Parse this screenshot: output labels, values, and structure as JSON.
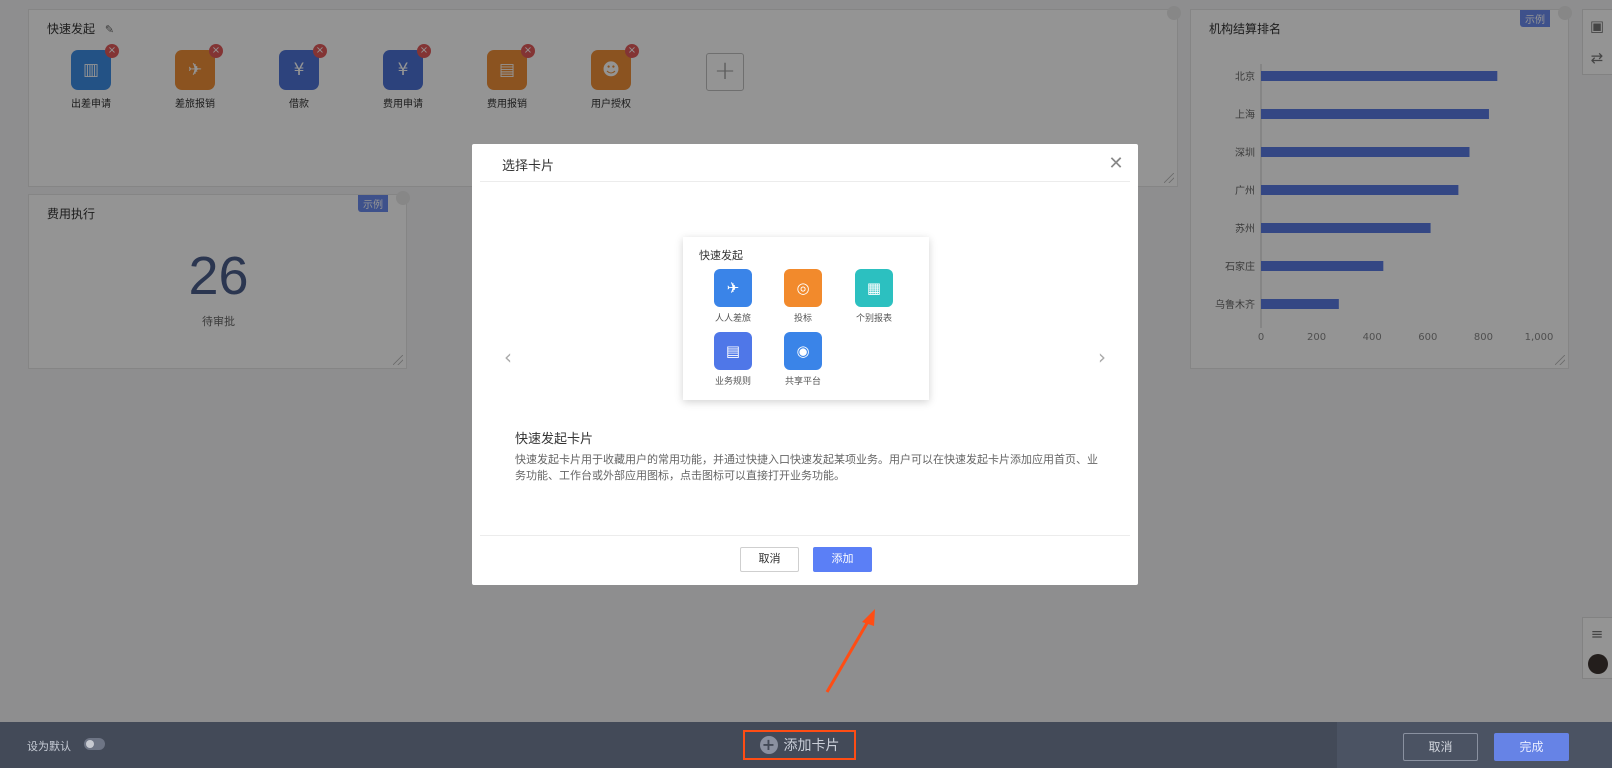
{
  "quick_launch": {
    "title": "快速发起",
    "items": [
      {
        "label": "出差申请",
        "color": "#3d8ee6",
        "icon": "luggage-icon",
        "glyph": "▥"
      },
      {
        "label": "差旅报销",
        "color": "#ef8f38",
        "icon": "plane-ticket-icon",
        "glyph": "✈"
      },
      {
        "label": "借款",
        "color": "#4f74d8",
        "icon": "money-icon",
        "glyph": "¥"
      },
      {
        "label": "费用申请",
        "color": "#4c72d6",
        "icon": "document-yen-icon",
        "glyph": "¥"
      },
      {
        "label": "费用报销",
        "color": "#ef8f38",
        "icon": "document-icon",
        "glyph": "▤"
      },
      {
        "label": "用户授权",
        "color": "#ef8f38",
        "icon": "user-auth-icon",
        "glyph": "☻"
      }
    ],
    "add_symbol": "+"
  },
  "expense_card": {
    "title": "费用执行",
    "badge": "示例",
    "value": "26",
    "caption": "待审批"
  },
  "ranking_card": {
    "title": "机构结算排名",
    "badge": "示例"
  },
  "chart_data": {
    "type": "bar",
    "orientation": "horizontal",
    "title": "机构结算排名",
    "categories": [
      "北京",
      "上海",
      "深圳",
      "广州",
      "苏州",
      "石家庄",
      "乌鲁木齐"
    ],
    "values": [
      850,
      820,
      750,
      710,
      610,
      440,
      280
    ],
    "xlim": [
      0,
      1000
    ],
    "xticks": [
      "0",
      "200",
      "400",
      "600",
      "800",
      "1,000"
    ],
    "grid": false,
    "bar_color": "#5b7be3"
  },
  "modal": {
    "title": "选择卡片",
    "close_symbol": "✕",
    "preview": {
      "title": "快速发起",
      "items": [
        {
          "label": "人人差旅",
          "color": "#3a84e8",
          "icon": "travel-icon",
          "glyph": "✈"
        },
        {
          "label": "投标",
          "color": "#f28a2c",
          "icon": "target-icon",
          "glyph": "◎"
        },
        {
          "label": "个别报表",
          "color": "#2cc0c0",
          "icon": "report-icon",
          "glyph": "▦"
        },
        {
          "label": "业务规则",
          "color": "#4f77e8",
          "icon": "book-icon",
          "glyph": "▤"
        },
        {
          "label": "共享平台",
          "color": "#3a84e8",
          "icon": "share-platform-icon",
          "glyph": "◉"
        }
      ]
    },
    "prev_symbol": "‹",
    "next_symbol": "›",
    "desc_title": "快速发起卡片",
    "desc_text": "快速发起卡片用于收藏用户的常用功能，并通过快捷入口快速发起某项业务。用户可以在快速发起卡片添加应用首页、业务功能、工作台或外部应用图标，点击图标可以直接打开业务功能。",
    "cancel_label": "取消",
    "add_label": "添加"
  },
  "bottom_bar": {
    "set_default_label": "设为默认",
    "add_card_label": "添加卡片",
    "add_card_symbol": "+",
    "cancel_label": "取消",
    "done_label": "完成"
  },
  "annotation_color": "#ff4d14"
}
